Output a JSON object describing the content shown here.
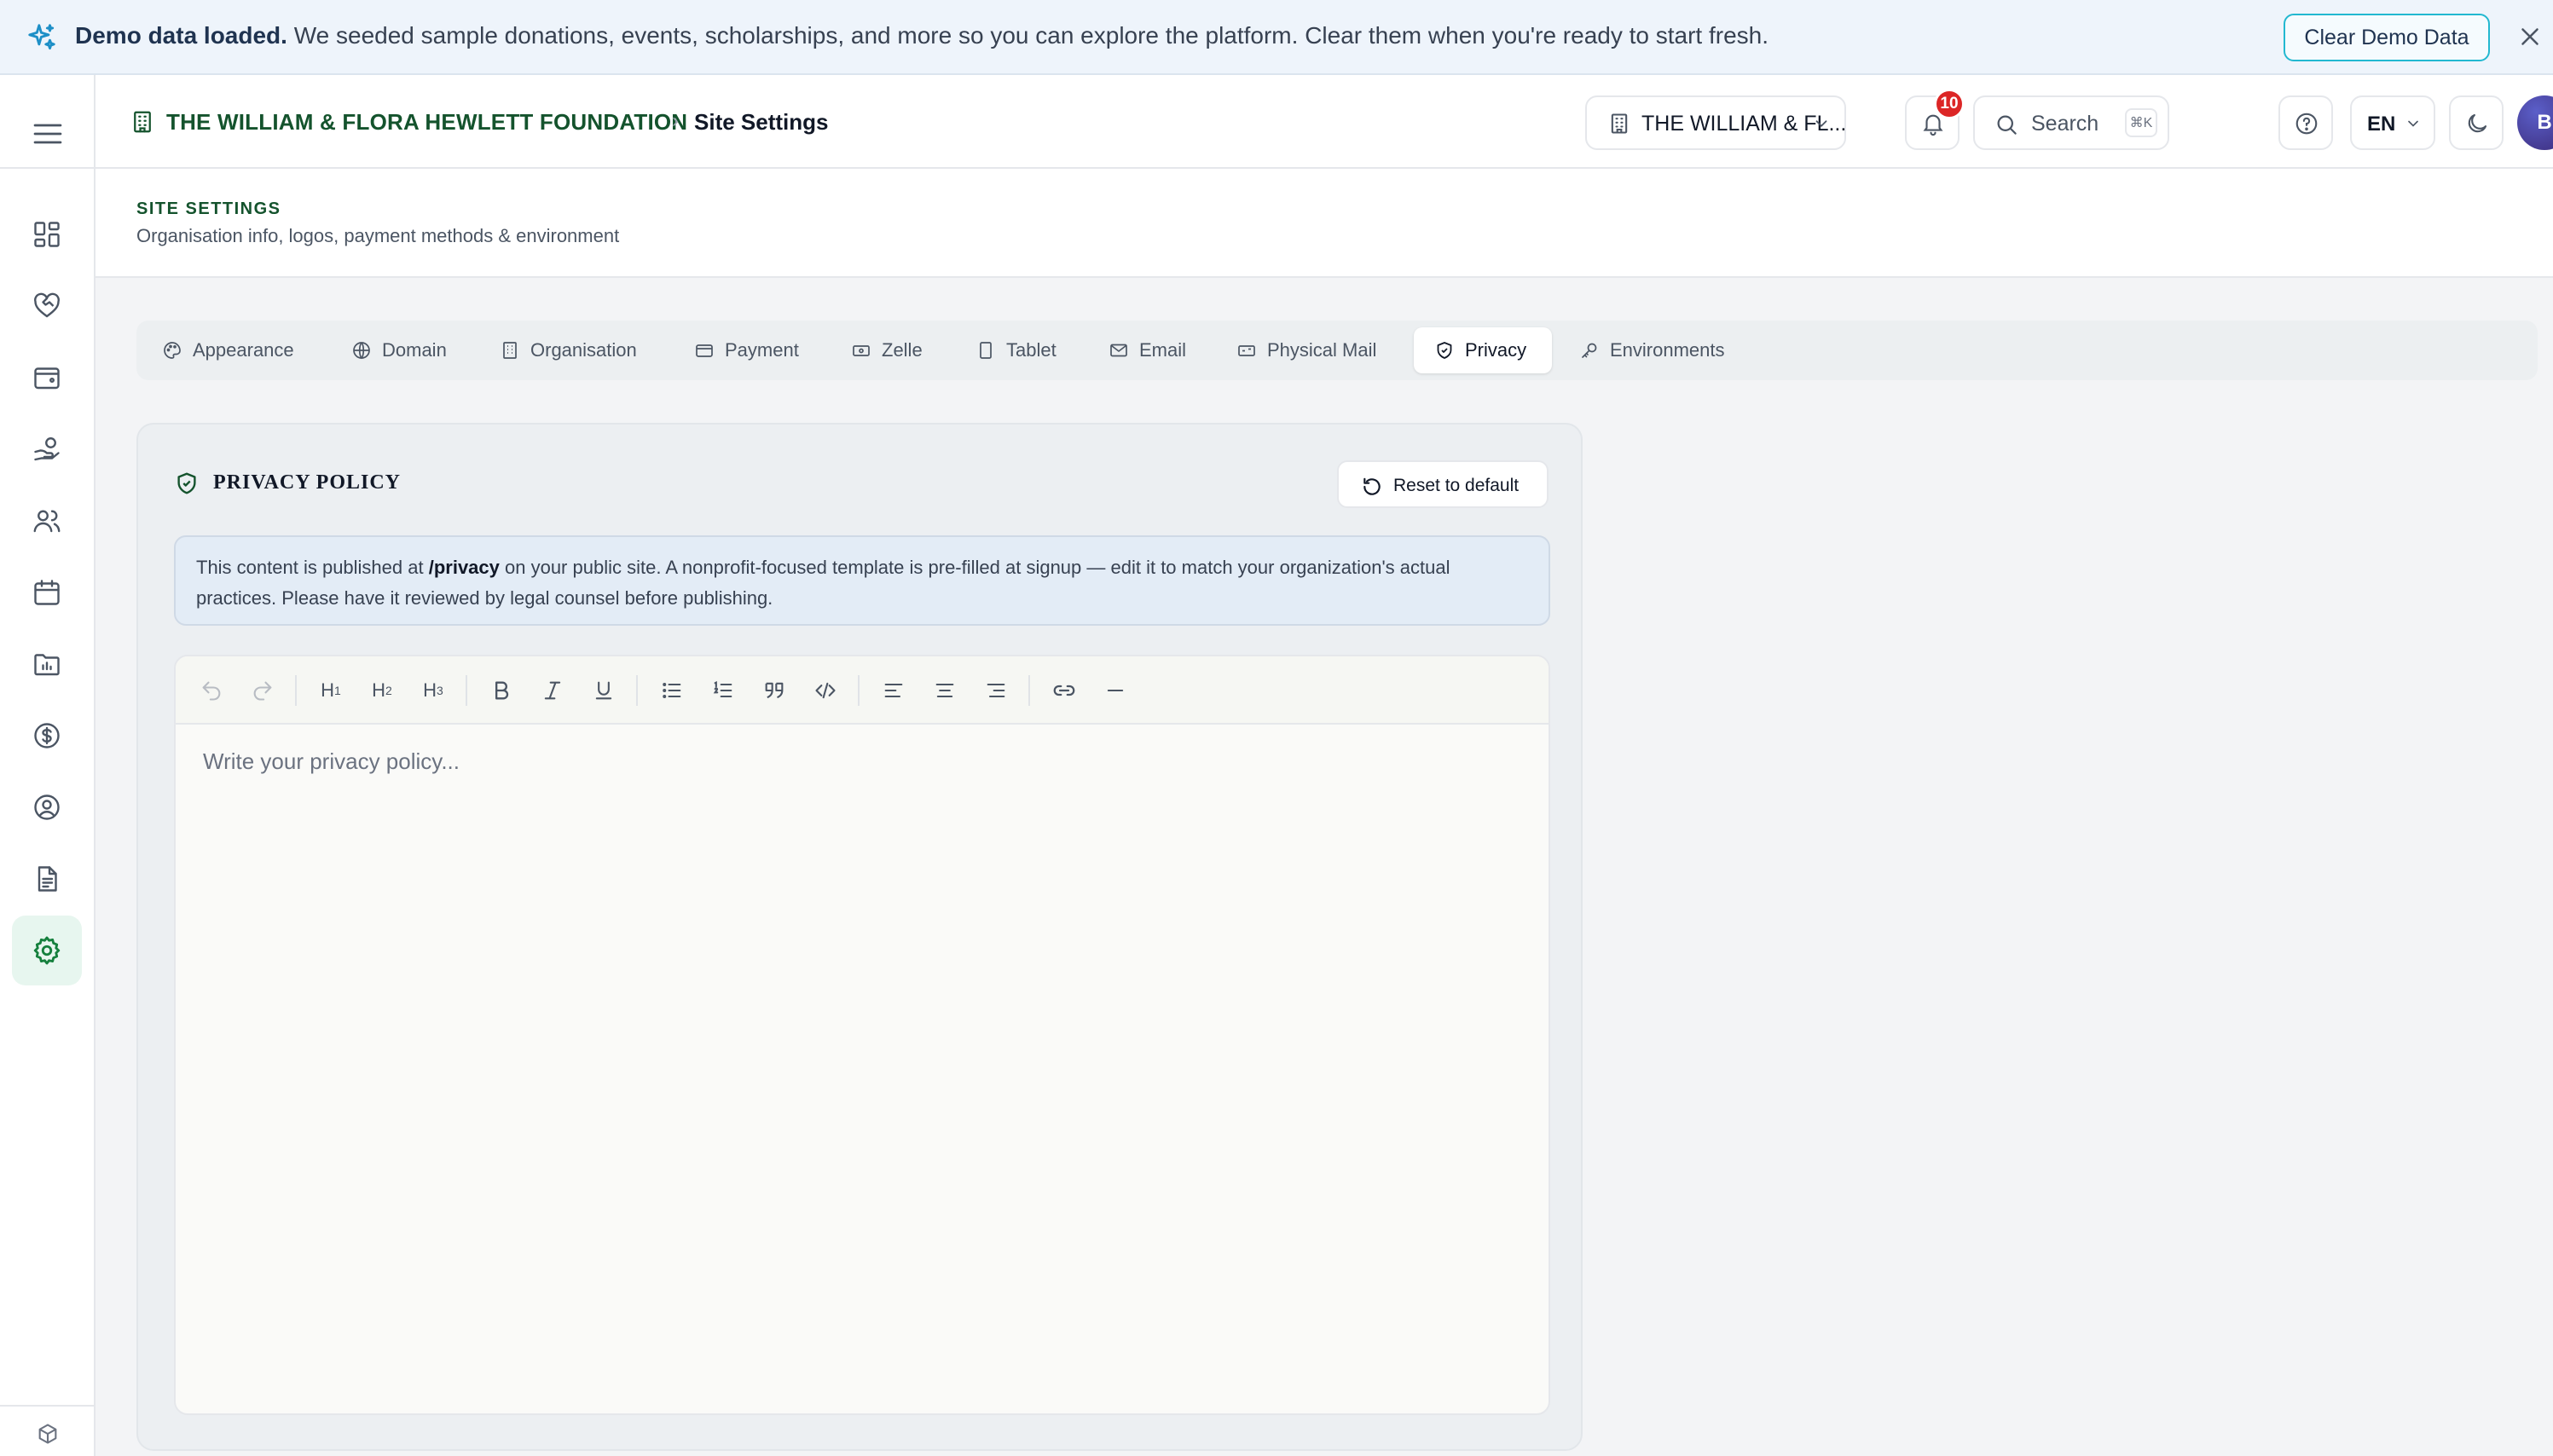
{
  "banner": {
    "title": "Demo data loaded.",
    "message": "We seeded sample donations, events, scholarships, and more so you can explore the platform. Clear them when you're ready to start fresh.",
    "clear_label": "Clear Demo Data"
  },
  "header": {
    "org_name": "THE WILLIAM & FLORA HEWLETT FOUNDATION",
    "separator": "›",
    "page_name": "Site Settings",
    "org_switch_label": "THE WILLIAM & FL...",
    "notifications_count": "10",
    "search_label": "Search",
    "search_shortcut": "⌘K",
    "language": "EN",
    "avatar_initial": "B"
  },
  "page": {
    "title": "SITE SETTINGS",
    "subtitle": "Organisation info, logos, payment methods & environment"
  },
  "tabs": [
    {
      "label": "Appearance",
      "icon": "palette-icon"
    },
    {
      "label": "Domain",
      "icon": "globe-icon"
    },
    {
      "label": "Organisation",
      "icon": "building-icon"
    },
    {
      "label": "Payment",
      "icon": "credit-card-icon"
    },
    {
      "label": "Zelle",
      "icon": "banknote-icon"
    },
    {
      "label": "Tablet",
      "icon": "tablet-icon"
    },
    {
      "label": "Email",
      "icon": "mail-icon"
    },
    {
      "label": "Physical Mail",
      "icon": "mailbox-icon"
    },
    {
      "label": "Privacy",
      "icon": "shield-icon",
      "active": true
    },
    {
      "label": "Environments",
      "icon": "key-icon"
    }
  ],
  "card": {
    "title": "PRIVACY POLICY",
    "reset_label": "Reset to default",
    "info_before": "This content is published at ",
    "info_path": "/privacy",
    "info_after": " on your public site. A nonprofit-focused template is pre-filled at signup — edit it to match your organization's actual practices. Please have it reviewed by legal counsel before publishing.",
    "editor_placeholder": "Write your privacy policy..."
  },
  "colors": {
    "accent": "#14532d",
    "banner_bg": "#eef4fb",
    "badge": "#dc2626",
    "active_nav_bg": "#e7f6ef"
  }
}
